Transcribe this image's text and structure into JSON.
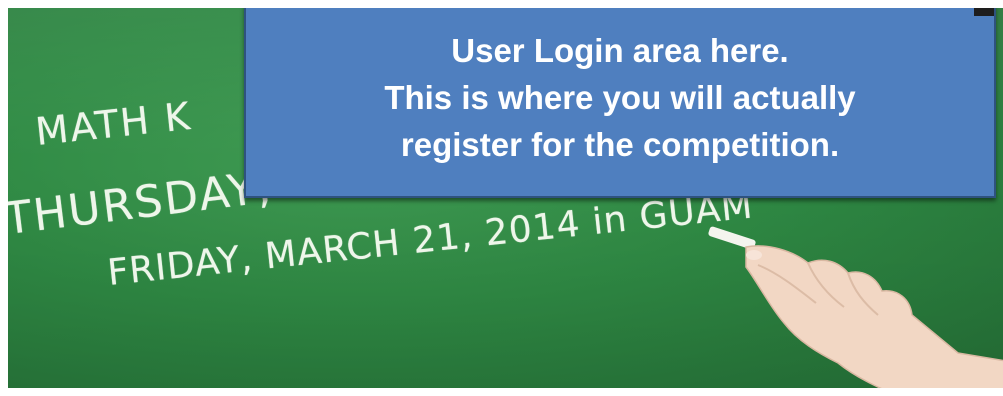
{
  "callout": {
    "lines": [
      "User Login area here.",
      "This is where you will actually",
      "register for the competition."
    ],
    "bg_color": "#4f7fbf",
    "border_color": "#2e527f"
  },
  "chalkboard": {
    "line1": "MATH K",
    "line2": "THURSDAY,",
    "line3": "FRIDAY, MARCH 21, 2014 in GUAM",
    "board_color": "#2f8a44"
  }
}
